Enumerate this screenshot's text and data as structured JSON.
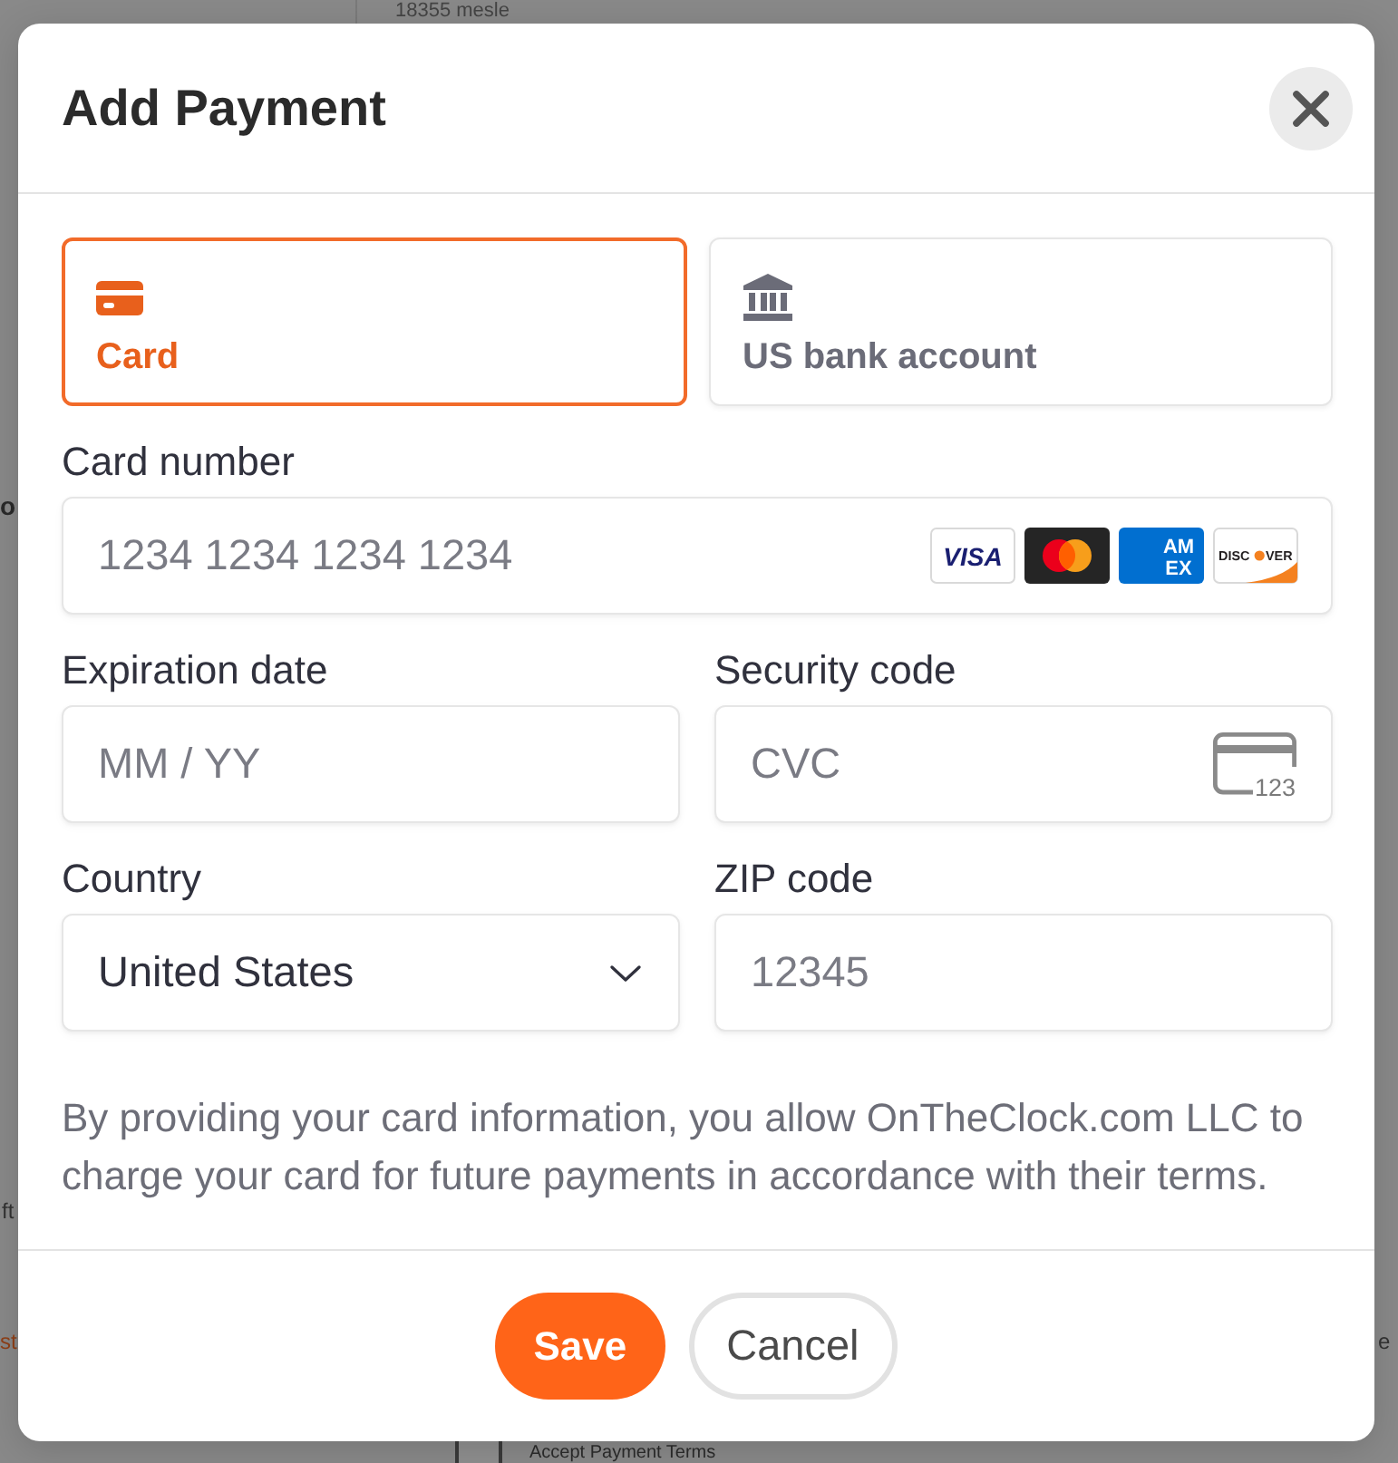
{
  "background": {
    "heading": "18355 mesle",
    "side_texts": [
      {
        "text": "o",
        "kind": "heading"
      },
      {
        "text": "ft",
        "kind": "plain"
      },
      {
        "text": "st",
        "kind": "link"
      },
      {
        "text": "e",
        "kind": "plain"
      }
    ],
    "terms": {
      "label": "Accept Payment Terms",
      "checked": false
    }
  },
  "dialog": {
    "title": "Add Payment",
    "methods": [
      {
        "label": "Card",
        "kind": "card",
        "selected": true
      },
      {
        "label": "US bank account",
        "kind": "bank",
        "selected": false
      }
    ],
    "fields": [
      {
        "kind": "card_number",
        "label": "Card number",
        "placeholder": "1234 1234 1234 1234",
        "brands": [
          {
            "kind": "visa",
            "lines": [
              "VISA"
            ]
          },
          {
            "kind": "mastercard"
          },
          {
            "kind": "amex",
            "lines": [
              "AM",
              "EX"
            ]
          },
          {
            "kind": "discover",
            "lines": [
              "DISC",
              "VER"
            ]
          }
        ]
      },
      {
        "kind": "text",
        "label": "Expiration date",
        "placeholder": "MM / YY"
      },
      {
        "kind": "cvc",
        "label": "Security code",
        "placeholder": "CVC",
        "icon_text": "123"
      },
      {
        "kind": "select",
        "label": "Country",
        "value": "United States"
      },
      {
        "kind": "text",
        "label": "ZIP code",
        "placeholder": "12345"
      }
    ],
    "notice": "By providing your card information, you allow OnTheClock.com LLC to charge your card for future payments in accordance with their terms.",
    "buttons": [
      {
        "label": "Save",
        "kind": "primary"
      },
      {
        "label": "Cancel",
        "kind": "secondary"
      }
    ]
  }
}
